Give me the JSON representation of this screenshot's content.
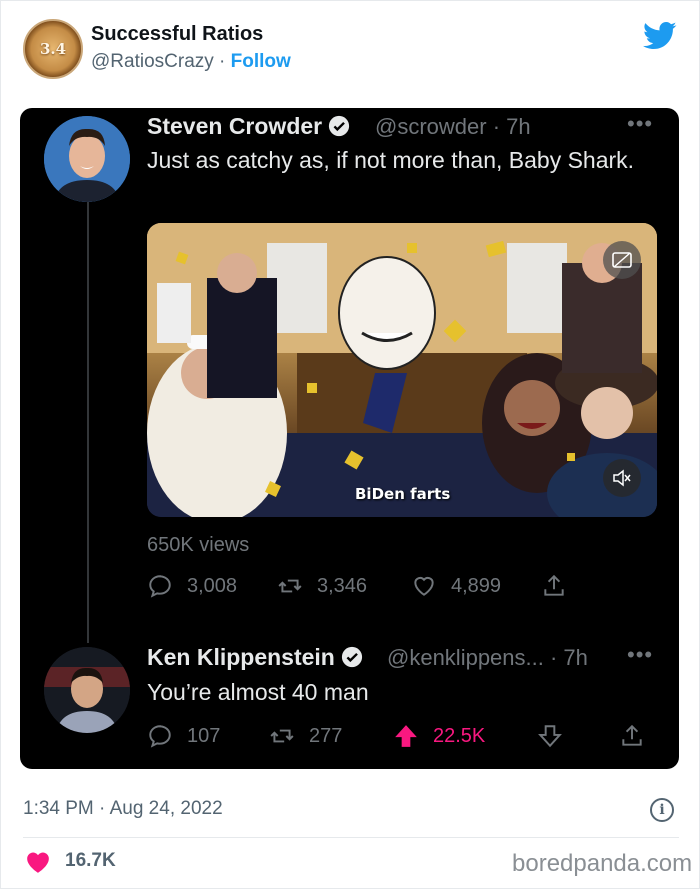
{
  "header": {
    "avatar_text": "3.4",
    "account_name": "Successful Ratios",
    "account_handle": "@RatiosCrazy",
    "separator": "·",
    "follow_label": "Follow"
  },
  "tweet_1": {
    "name": "Steven Crowder",
    "handle_time": "@scrowder · 7h",
    "text": "Just as catchy as, if not more than, Baby Shark.",
    "video_caption": "BiDen farts",
    "views": "650K views",
    "replies": "3,008",
    "retweets": "3,346",
    "likes": "4,899"
  },
  "tweet_2": {
    "name": "Ken Klippenstein",
    "handle_time": "@kenklippens... · 7h",
    "text": "You’re almost 40 man",
    "replies": "107",
    "retweets": "277",
    "upvotes": "22.5K"
  },
  "footer": {
    "timestamp": "1:34 PM · Aug 24, 2022",
    "like_count": "16.7K",
    "brand": "boredpanda.com"
  },
  "colors": {
    "accent": "#1d9bf0",
    "upvote": "#f91880",
    "heart": "#f91880",
    "dark_bg": "#000000"
  },
  "icons": [
    "twitter-bird-icon",
    "verified-badge-icon",
    "more-dots-icon",
    "cc-icon",
    "mute-icon",
    "reply-icon",
    "retweet-icon",
    "like-icon",
    "share-icon",
    "upvote-arrow-icon",
    "downvote-arrow-icon",
    "info-icon",
    "heart-icon"
  ]
}
